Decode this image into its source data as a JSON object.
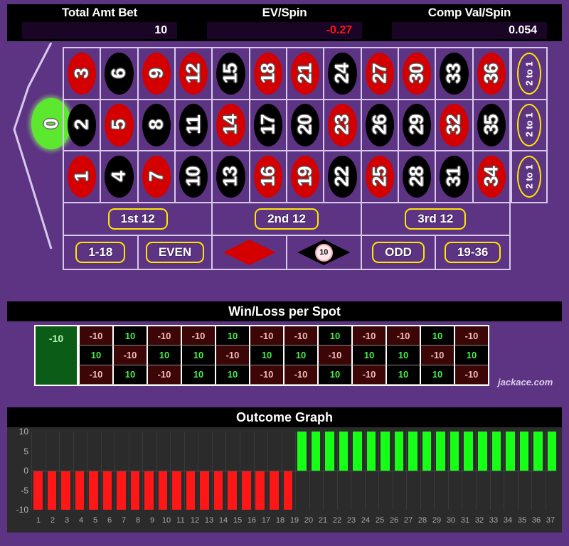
{
  "header": {
    "stats": [
      {
        "label": "Total Amt Bet",
        "value": "10",
        "negative": false
      },
      {
        "label": "EV/Spin",
        "value": "-0.27",
        "negative": true
      },
      {
        "label": "Comp Val/Spin",
        "value": "0.054",
        "negative": false
      }
    ]
  },
  "table": {
    "zero": {
      "label": "0",
      "color": "green"
    },
    "numbers": [
      {
        "n": "3",
        "color": "red"
      },
      {
        "n": "2",
        "color": "black"
      },
      {
        "n": "1",
        "color": "red"
      },
      {
        "n": "6",
        "color": "black"
      },
      {
        "n": "5",
        "color": "red"
      },
      {
        "n": "4",
        "color": "black"
      },
      {
        "n": "9",
        "color": "red"
      },
      {
        "n": "8",
        "color": "black"
      },
      {
        "n": "7",
        "color": "red"
      },
      {
        "n": "12",
        "color": "red"
      },
      {
        "n": "11",
        "color": "black"
      },
      {
        "n": "10",
        "color": "black"
      },
      {
        "n": "15",
        "color": "black"
      },
      {
        "n": "14",
        "color": "red"
      },
      {
        "n": "13",
        "color": "black"
      },
      {
        "n": "18",
        "color": "red"
      },
      {
        "n": "17",
        "color": "black"
      },
      {
        "n": "16",
        "color": "red"
      },
      {
        "n": "21",
        "color": "red"
      },
      {
        "n": "20",
        "color": "black"
      },
      {
        "n": "19",
        "color": "red"
      },
      {
        "n": "24",
        "color": "black"
      },
      {
        "n": "23",
        "color": "red"
      },
      {
        "n": "22",
        "color": "black"
      },
      {
        "n": "27",
        "color": "red"
      },
      {
        "n": "26",
        "color": "black"
      },
      {
        "n": "25",
        "color": "red"
      },
      {
        "n": "30",
        "color": "red"
      },
      {
        "n": "29",
        "color": "black"
      },
      {
        "n": "28",
        "color": "black"
      },
      {
        "n": "33",
        "color": "black"
      },
      {
        "n": "32",
        "color": "red"
      },
      {
        "n": "31",
        "color": "black"
      },
      {
        "n": "36",
        "color": "red"
      },
      {
        "n": "35",
        "color": "black"
      },
      {
        "n": "34",
        "color": "red"
      }
    ],
    "column_bets": [
      "2 to 1",
      "2 to 1",
      "2 to 1"
    ],
    "dozens": [
      "1st 12",
      "2nd 12",
      "3rd 12"
    ],
    "outside": [
      {
        "type": "text",
        "label": "1-18"
      },
      {
        "type": "text",
        "label": "EVEN"
      },
      {
        "type": "diamond",
        "label": "",
        "color": "red"
      },
      {
        "type": "diamond",
        "label": "",
        "color": "black",
        "chip": "10"
      },
      {
        "type": "text",
        "label": "ODD"
      },
      {
        "type": "text",
        "label": "19-36"
      }
    ]
  },
  "winloss": {
    "title": "Win/Loss per Spot",
    "zero_value": "-10",
    "rows": [
      [
        "-10",
        "10",
        "-10",
        "-10",
        "10",
        "-10",
        "-10",
        "10",
        "-10",
        "-10",
        "10",
        "-10"
      ],
      [
        "10",
        "-10",
        "10",
        "10",
        "-10",
        "10",
        "10",
        "-10",
        "10",
        "10",
        "-10",
        "10"
      ],
      [
        "-10",
        "10",
        "-10",
        "10",
        "10",
        "-10",
        "-10",
        "10",
        "-10",
        "10",
        "10",
        "-10"
      ]
    ],
    "watermark": "jackace.com"
  },
  "chart_data": {
    "type": "bar",
    "title": "Outcome Graph",
    "xlabel": "",
    "ylabel": "",
    "ylim": [
      -10,
      10
    ],
    "yticks": [
      "10",
      "5",
      "0",
      "-5",
      "-10"
    ],
    "grid": true,
    "legend": "none",
    "categories": [
      "1",
      "2",
      "3",
      "4",
      "5",
      "6",
      "7",
      "8",
      "9",
      "10",
      "11",
      "12",
      "13",
      "14",
      "15",
      "16",
      "17",
      "18",
      "19",
      "20",
      "21",
      "22",
      "23",
      "24",
      "25",
      "26",
      "27",
      "28",
      "29",
      "30",
      "31",
      "32",
      "33",
      "34",
      "35",
      "36",
      "37"
    ],
    "values": [
      -10,
      -10,
      -10,
      -10,
      -10,
      -10,
      -10,
      -10,
      -10,
      -10,
      -10,
      -10,
      -10,
      -10,
      -10,
      -10,
      -10,
      -10,
      -10,
      10,
      10,
      10,
      10,
      10,
      10,
      10,
      10,
      10,
      10,
      10,
      10,
      10,
      10,
      10,
      10,
      10,
      10,
      10
    ],
    "colors": {
      "positive": "#16ff16",
      "negative": "#ff1616"
    }
  }
}
